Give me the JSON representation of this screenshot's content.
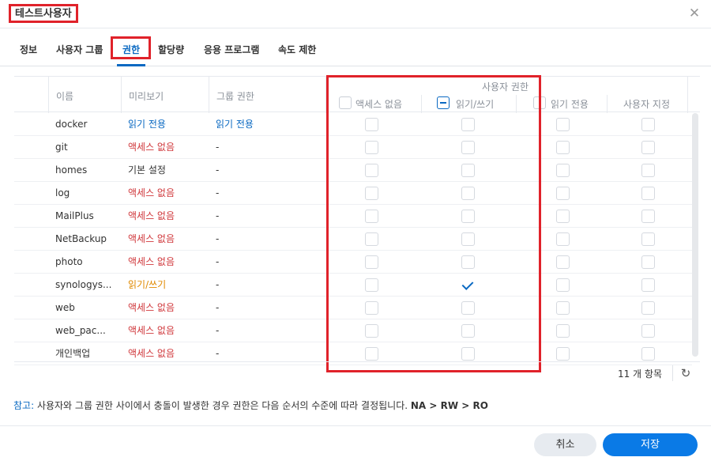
{
  "window": {
    "title": "테스트사용자"
  },
  "tabs": [
    "정보",
    "사용자 그룹",
    "권한",
    "할당량",
    "응용 프로그램",
    "속도 제한"
  ],
  "active_tab": "권한",
  "grid": {
    "headers": {
      "name": "이름",
      "preview": "미리보기",
      "group_perm": "그룹 권한",
      "user_perm": "사용자 권한",
      "no_access": "액세스 없음",
      "read_write": "읽기/쓰기",
      "read_only": "읽기 전용",
      "custom": "사용자 지정"
    },
    "rows": [
      {
        "name": "docker",
        "preview": "읽기 전용",
        "preview_color": "blue",
        "group": "읽기 전용",
        "group_color": "blue",
        "rw_checked": false
      },
      {
        "name": "git",
        "preview": "액세스 없음",
        "preview_color": "red",
        "group": "-",
        "group_color": "",
        "rw_checked": false
      },
      {
        "name": "homes",
        "preview": "기본 설정",
        "preview_color": "",
        "group": "-",
        "group_color": "",
        "rw_checked": false
      },
      {
        "name": "log",
        "preview": "액세스 없음",
        "preview_color": "red",
        "group": "-",
        "group_color": "",
        "rw_checked": false
      },
      {
        "name": "MailPlus",
        "preview": "액세스 없음",
        "preview_color": "red",
        "group": "-",
        "group_color": "",
        "rw_checked": false
      },
      {
        "name": "NetBackup",
        "preview": "액세스 없음",
        "preview_color": "red",
        "group": "-",
        "group_color": "",
        "rw_checked": false
      },
      {
        "name": "photo",
        "preview": "액세스 없음",
        "preview_color": "red",
        "group": "-",
        "group_color": "",
        "rw_checked": false
      },
      {
        "name": "synologys...",
        "preview": "읽기/쓰기",
        "preview_color": "orange",
        "group": "-",
        "group_color": "",
        "rw_checked": true
      },
      {
        "name": "web",
        "preview": "액세스 없음",
        "preview_color": "red",
        "group": "-",
        "group_color": "",
        "rw_checked": false
      },
      {
        "name": "web_pac...",
        "preview": "액세스 없음",
        "preview_color": "red",
        "group": "-",
        "group_color": "",
        "rw_checked": false
      },
      {
        "name": "개인백업",
        "preview": "액세스 없음",
        "preview_color": "red",
        "group": "-",
        "group_color": "",
        "rw_checked": false
      }
    ],
    "item_count": "11 개 항목"
  },
  "note": {
    "label": "참고:",
    "text": " 사용자와 그룹 권한 사이에서 충돌이 발생한 경우 권한은 다음 순서의 수준에 따라 결정됩니다.",
    "order": "NA > RW > RO"
  },
  "buttons": {
    "cancel": "취소",
    "save": "저장"
  },
  "colors": {
    "accent": "#0a69c2",
    "save_button": "#0a7ae6",
    "no_access": "#d0383c",
    "read_write": "#e08a00",
    "highlight": "#e0222a"
  },
  "icons": {
    "close": "close-icon",
    "refresh": "refresh-icon",
    "check": "checkmark-icon"
  }
}
